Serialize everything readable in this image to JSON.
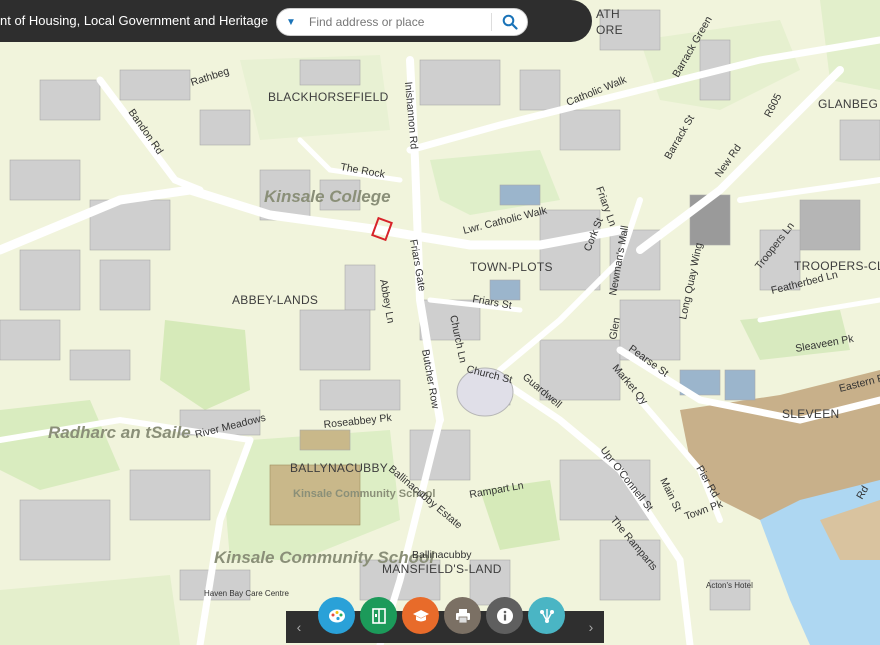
{
  "header": {
    "title": "nt of Housing, Local Government and Heritage"
  },
  "search": {
    "placeholder": "Find address or place",
    "value": "",
    "dropdown_icon": "caret-down-icon",
    "button_icon": "search-icon"
  },
  "map": {
    "large_labels": [
      "Kinsale College",
      "Radharc an tSaile",
      "Kinsale Community School",
      "Kinsale Community School"
    ],
    "area_labels": [
      "BLACKHORSEFIELD",
      "TOWN-PLOTS",
      "ABBEY-LANDS",
      "BALLYNACUBBY",
      "MANSFIELD'S-LAND",
      "SLEVEEN",
      "GLANBEG",
      "TROOPERS-CL",
      "ATH",
      "ORE"
    ],
    "street_labels": [
      "Rathbeg",
      "Bandon Rd",
      "Inishannon Rd",
      "Catholic Walk",
      "Barrack Green",
      "Barrack St",
      "R605",
      "New Rd",
      "The Rock",
      "Lwr. Catholic Walk",
      "Friars Gate",
      "Friary Ln",
      "Cork St",
      "Troopers Ln",
      "Featherbed Ln",
      "Abbey Ln",
      "Friars St",
      "Newman's Mall",
      "Glen",
      "Long Quay Wing",
      "Church Ln",
      "Butcher Row",
      "Church St",
      "Guardwell",
      "Market Qy",
      "Pearse St",
      "Sleaveen Pk",
      "Eastern Rd",
      "River Meadows",
      "Roseabbey Pk",
      "Ballinacubby Estate",
      "Rampart Ln",
      "Upr O'Connell St",
      "Main St",
      "Pier Rd",
      "Town Pk",
      "The Ramparts",
      "Ballinacubby",
      "Haven Bay Care Centre",
      "Acton's Hotel",
      "Rd"
    ]
  },
  "toolbar": {
    "prev_icon": "chevron-left-icon",
    "next_icon": "chevron-right-icon",
    "buttons": [
      {
        "name": "basemap-gallery",
        "icon": "palette-icon",
        "color": "#2aa1d8"
      },
      {
        "name": "layer-list",
        "icon": "layers-icon",
        "color": "#1c9a5a"
      },
      {
        "name": "legend",
        "icon": "graduation-cap-icon",
        "color": "#e86b2a"
      },
      {
        "name": "print",
        "icon": "printer-icon",
        "color": "#7b7064"
      },
      {
        "name": "about",
        "icon": "info-icon",
        "color": "#5f5f5f"
      },
      {
        "name": "share",
        "icon": "share-icon",
        "color": "#4ab5c4"
      }
    ]
  },
  "colors": {
    "background": "#f1f4dc",
    "water": "#aed7f2",
    "mud": "#c8b08a",
    "green_area": "#d6eab9",
    "road": "#ffffff",
    "building": "#c8c8c8",
    "header": "#2e2e2e",
    "selected_parcel": "#d8232a"
  }
}
